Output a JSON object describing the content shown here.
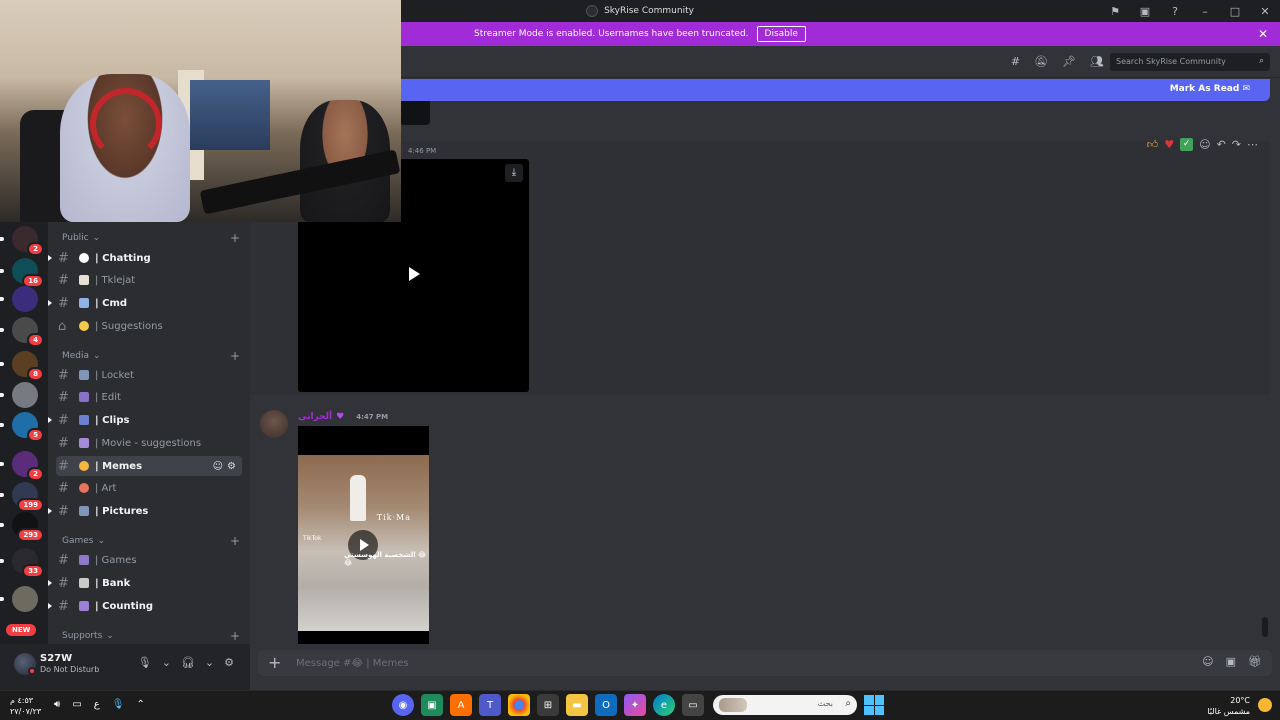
{
  "window": {
    "title": "SkyRise Community"
  },
  "streamer_banner": {
    "text": "Streamer Mode is enabled. Usernames have been truncated.",
    "disable_label": "Disable"
  },
  "servers": [
    {
      "badge": "2",
      "color": "#3a2a2e"
    },
    {
      "badge": "16",
      "color": "#0f4d57"
    },
    {
      "badge": "",
      "color": "#3b2d7c"
    },
    {
      "badge": "4",
      "color": "#4a4a4a"
    },
    {
      "badge": "8",
      "color": "#5a3f22"
    },
    {
      "badge": "",
      "color": "#777a80"
    },
    {
      "badge": "5",
      "color": "#1e6ea8"
    },
    {
      "badge": "2",
      "color": "#5a2c7a"
    },
    {
      "badge": "199",
      "color": "#313a52"
    },
    {
      "badge": "293",
      "color": "#111214"
    },
    {
      "badge": "33",
      "color": "#2a2a2e"
    },
    {
      "badge": "",
      "color": "#6d6a60"
    }
  ],
  "new_badge": "NEW",
  "sidebar": {
    "categories": [
      {
        "label": "Public"
      },
      {
        "label": "Media"
      },
      {
        "label": "Games"
      },
      {
        "label": "Supports"
      }
    ],
    "channels": [
      {
        "name": "| Chatting",
        "emoji_color": "#ffffff"
      },
      {
        "name": "| Tklejat",
        "emoji_color": "#e8e0d4"
      },
      {
        "name": "| Cmd",
        "emoji_color": "#8fb3e6"
      },
      {
        "name": "| Suggestions",
        "emoji_color": "#f7c948"
      },
      {
        "name": "| Locket",
        "emoji_color": "#7f96b8"
      },
      {
        "name": "| Edit",
        "emoji_color": "#8a71c9"
      },
      {
        "name": "| Clips",
        "emoji_color": "#6d7fd1"
      },
      {
        "name": "| Movie - suggestions",
        "emoji_color": "#a68ad8"
      },
      {
        "name": "| Memes",
        "emoji_color": "#f5b642"
      },
      {
        "name": "| Art",
        "emoji_color": "#e8735a"
      },
      {
        "name": "| Pictures",
        "emoji_color": "#7f96b8"
      },
      {
        "name": "| Games",
        "emoji_color": "#8d79c8"
      },
      {
        "name": "| Bank",
        "emoji_color": "#c9c9c9"
      },
      {
        "name": "| Counting",
        "emoji_color": "#9d7fd6"
      }
    ]
  },
  "user": {
    "name": "S27W",
    "status": "Do Not Disturb"
  },
  "header": {
    "search_placeholder": "Search SkyRise Community"
  },
  "new_messages_bar": {
    "label": "Mark As Read"
  },
  "messages": [
    {
      "timestamp": "4:46 PM"
    },
    {
      "author": "ألجراني",
      "timestamp": "4:47 PM",
      "video_watermark": "Tik·Ma",
      "video_caption": "الشخصية الهوسستي 😂😂",
      "video_brand": "TikTok"
    }
  ],
  "composer": {
    "placeholder": "Message #😂 | Memes"
  },
  "taskbar": {
    "time": "٤:٥٣ م",
    "date": "٢٧/٠٧/٢٣",
    "language": "ع",
    "search_placeholder": "بحث",
    "temperature": "20°C",
    "weather": "مشمس غالبًا"
  }
}
